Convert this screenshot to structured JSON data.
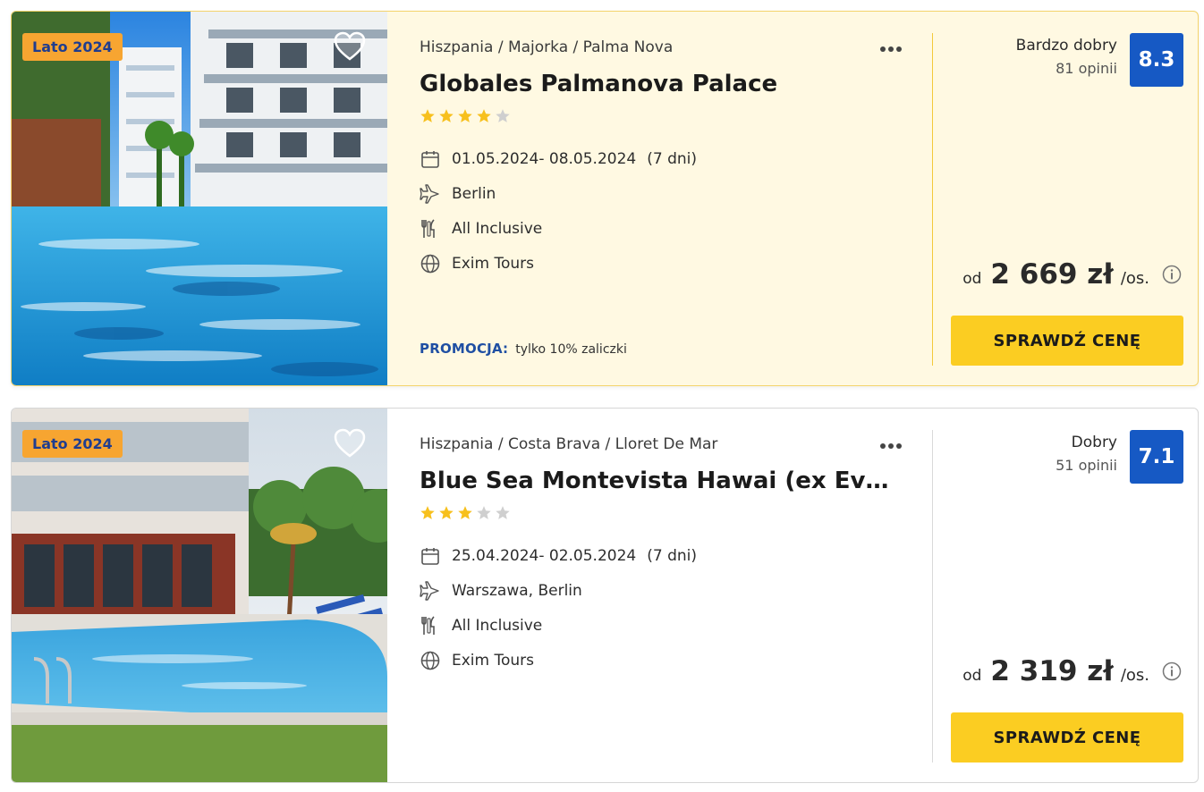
{
  "colors": {
    "accent": "#fbcd22",
    "score_bg": "#1659c4",
    "badge_bg": "#f7a531",
    "promo_label": "#1f4fa3",
    "star": "#f7c01d",
    "star_empty": "#cfcfcf"
  },
  "offers": [
    {
      "season_badge": "Lato 2024",
      "breadcrumb": "Hiszpania / Majorka / Palma Nova",
      "name": "Globales Palmanova Palace",
      "stars_filled": 4,
      "stars_total": 5,
      "dates": "01.05.2024- 08.05.2024",
      "duration": "(7 dni)",
      "departure": "Berlin",
      "board": "All Inclusive",
      "operator": "Exim Tours",
      "promo_label": "PROMOCJA:",
      "promo_text": "tylko 10% zaliczki",
      "rating_label": "Bardzo dobry",
      "rating_reviews": "81 opinii",
      "rating_score": "8.3",
      "price_prefix": "od",
      "price": "2 669 zł",
      "price_suffix": "/os.",
      "cta": "SPRAWDŹ CENĘ",
      "icons": {
        "favorite": "heart-icon",
        "more": "more-icon",
        "date": "calendar-icon",
        "departure": "plane-icon",
        "board": "cutlery-icon",
        "operator": "globe-icon",
        "price_info": "info-icon"
      }
    },
    {
      "season_badge": "Lato 2024",
      "breadcrumb": "Hiszpania / Costa Brava / Lloret De Mar",
      "name": "Blue Sea Montevista Hawai (ex Evenia Montevista Hawai)",
      "stars_filled": 3,
      "stars_total": 5,
      "dates": "25.04.2024- 02.05.2024",
      "duration": "(7 dni)",
      "departure": "Warszawa, Berlin",
      "board": "All Inclusive",
      "operator": "Exim Tours",
      "rating_label": "Dobry",
      "rating_reviews": "51 opinii",
      "rating_score": "7.1",
      "price_prefix": "od",
      "price": "2 319 zł",
      "price_suffix": "/os.",
      "cta": "SPRAWDŹ CENĘ",
      "icons": {
        "favorite": "heart-icon",
        "more": "more-icon",
        "date": "calendar-icon",
        "departure": "plane-icon",
        "board": "cutlery-icon",
        "operator": "globe-icon",
        "price_info": "info-icon"
      }
    }
  ]
}
